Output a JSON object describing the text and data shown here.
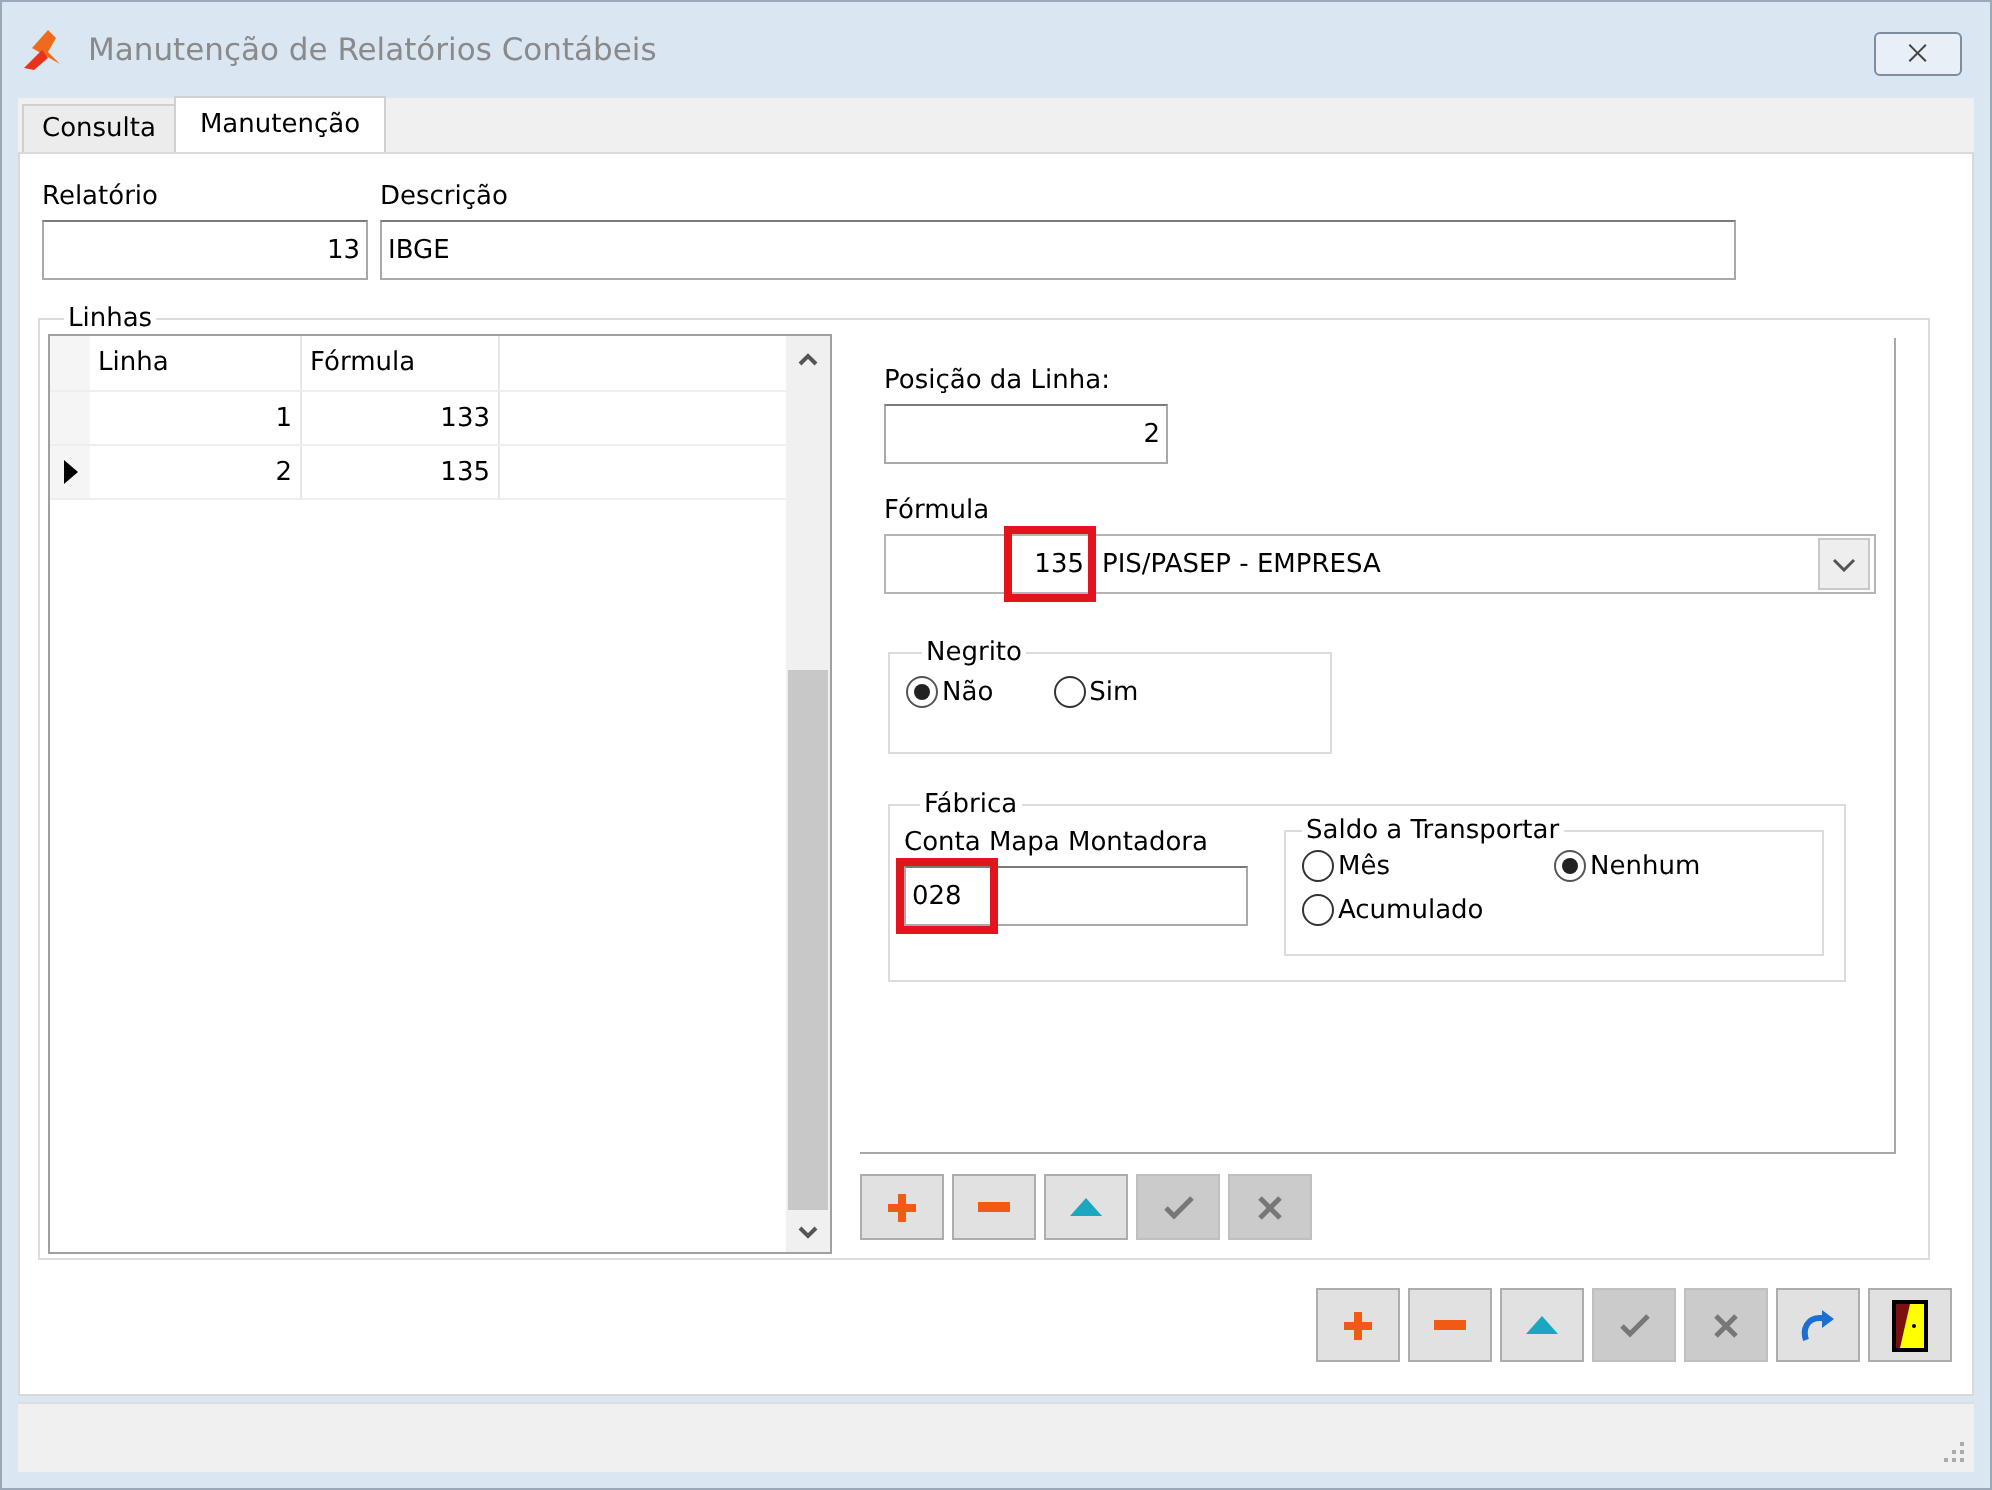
{
  "window": {
    "title": "Manutenção de Relatórios Contábeis",
    "close_symbol": "⨉"
  },
  "tabs": [
    {
      "label": "Consulta",
      "selected": false
    },
    {
      "label": "Manutenção",
      "selected": true
    }
  ],
  "relatorio": {
    "label": "Relatório",
    "value": "13"
  },
  "descricao": {
    "label": "Descrição",
    "value": "IBGE"
  },
  "linhas": {
    "title": "Linhas",
    "grid": {
      "columns": [
        "Linha",
        "Fórmula"
      ],
      "rows": [
        {
          "cells": [
            "1",
            "133"
          ],
          "selected": false
        },
        {
          "cells": [
            "2",
            "135"
          ],
          "selected": true
        }
      ]
    },
    "posicao": {
      "label": "Posição da Linha:",
      "value": "2"
    },
    "formula": {
      "label": "Fórmula",
      "code": "135",
      "description": "PIS/PASEP - EMPRESA",
      "highlighted": true
    },
    "negrito": {
      "title": "Negrito",
      "options": [
        {
          "label": "Não",
          "selected": true
        },
        {
          "label": "Sim",
          "selected": false
        }
      ]
    },
    "fabrica": {
      "title": "Fábrica",
      "conta": {
        "label": "Conta Mapa Montadora",
        "value": "028",
        "highlighted": true
      },
      "saldo": {
        "title": "Saldo a Transportar",
        "options": [
          {
            "label": "Mês",
            "selected": false
          },
          {
            "label": "Nenhum",
            "selected": true
          },
          {
            "label": "Acumulado",
            "selected": false
          }
        ]
      }
    },
    "buttons": [
      {
        "kind": "add",
        "disabled": false
      },
      {
        "kind": "remove",
        "disabled": false
      },
      {
        "kind": "up",
        "disabled": false
      },
      {
        "kind": "confirm",
        "disabled": true
      },
      {
        "kind": "cancel",
        "disabled": true
      }
    ]
  },
  "buttons": [
    {
      "kind": "add",
      "disabled": false
    },
    {
      "kind": "remove",
      "disabled": false
    },
    {
      "kind": "up",
      "disabled": false
    },
    {
      "kind": "confirm",
      "disabled": true
    },
    {
      "kind": "cancel",
      "disabled": true
    },
    {
      "kind": "redo",
      "disabled": false
    },
    {
      "kind": "exit",
      "disabled": false
    }
  ]
}
